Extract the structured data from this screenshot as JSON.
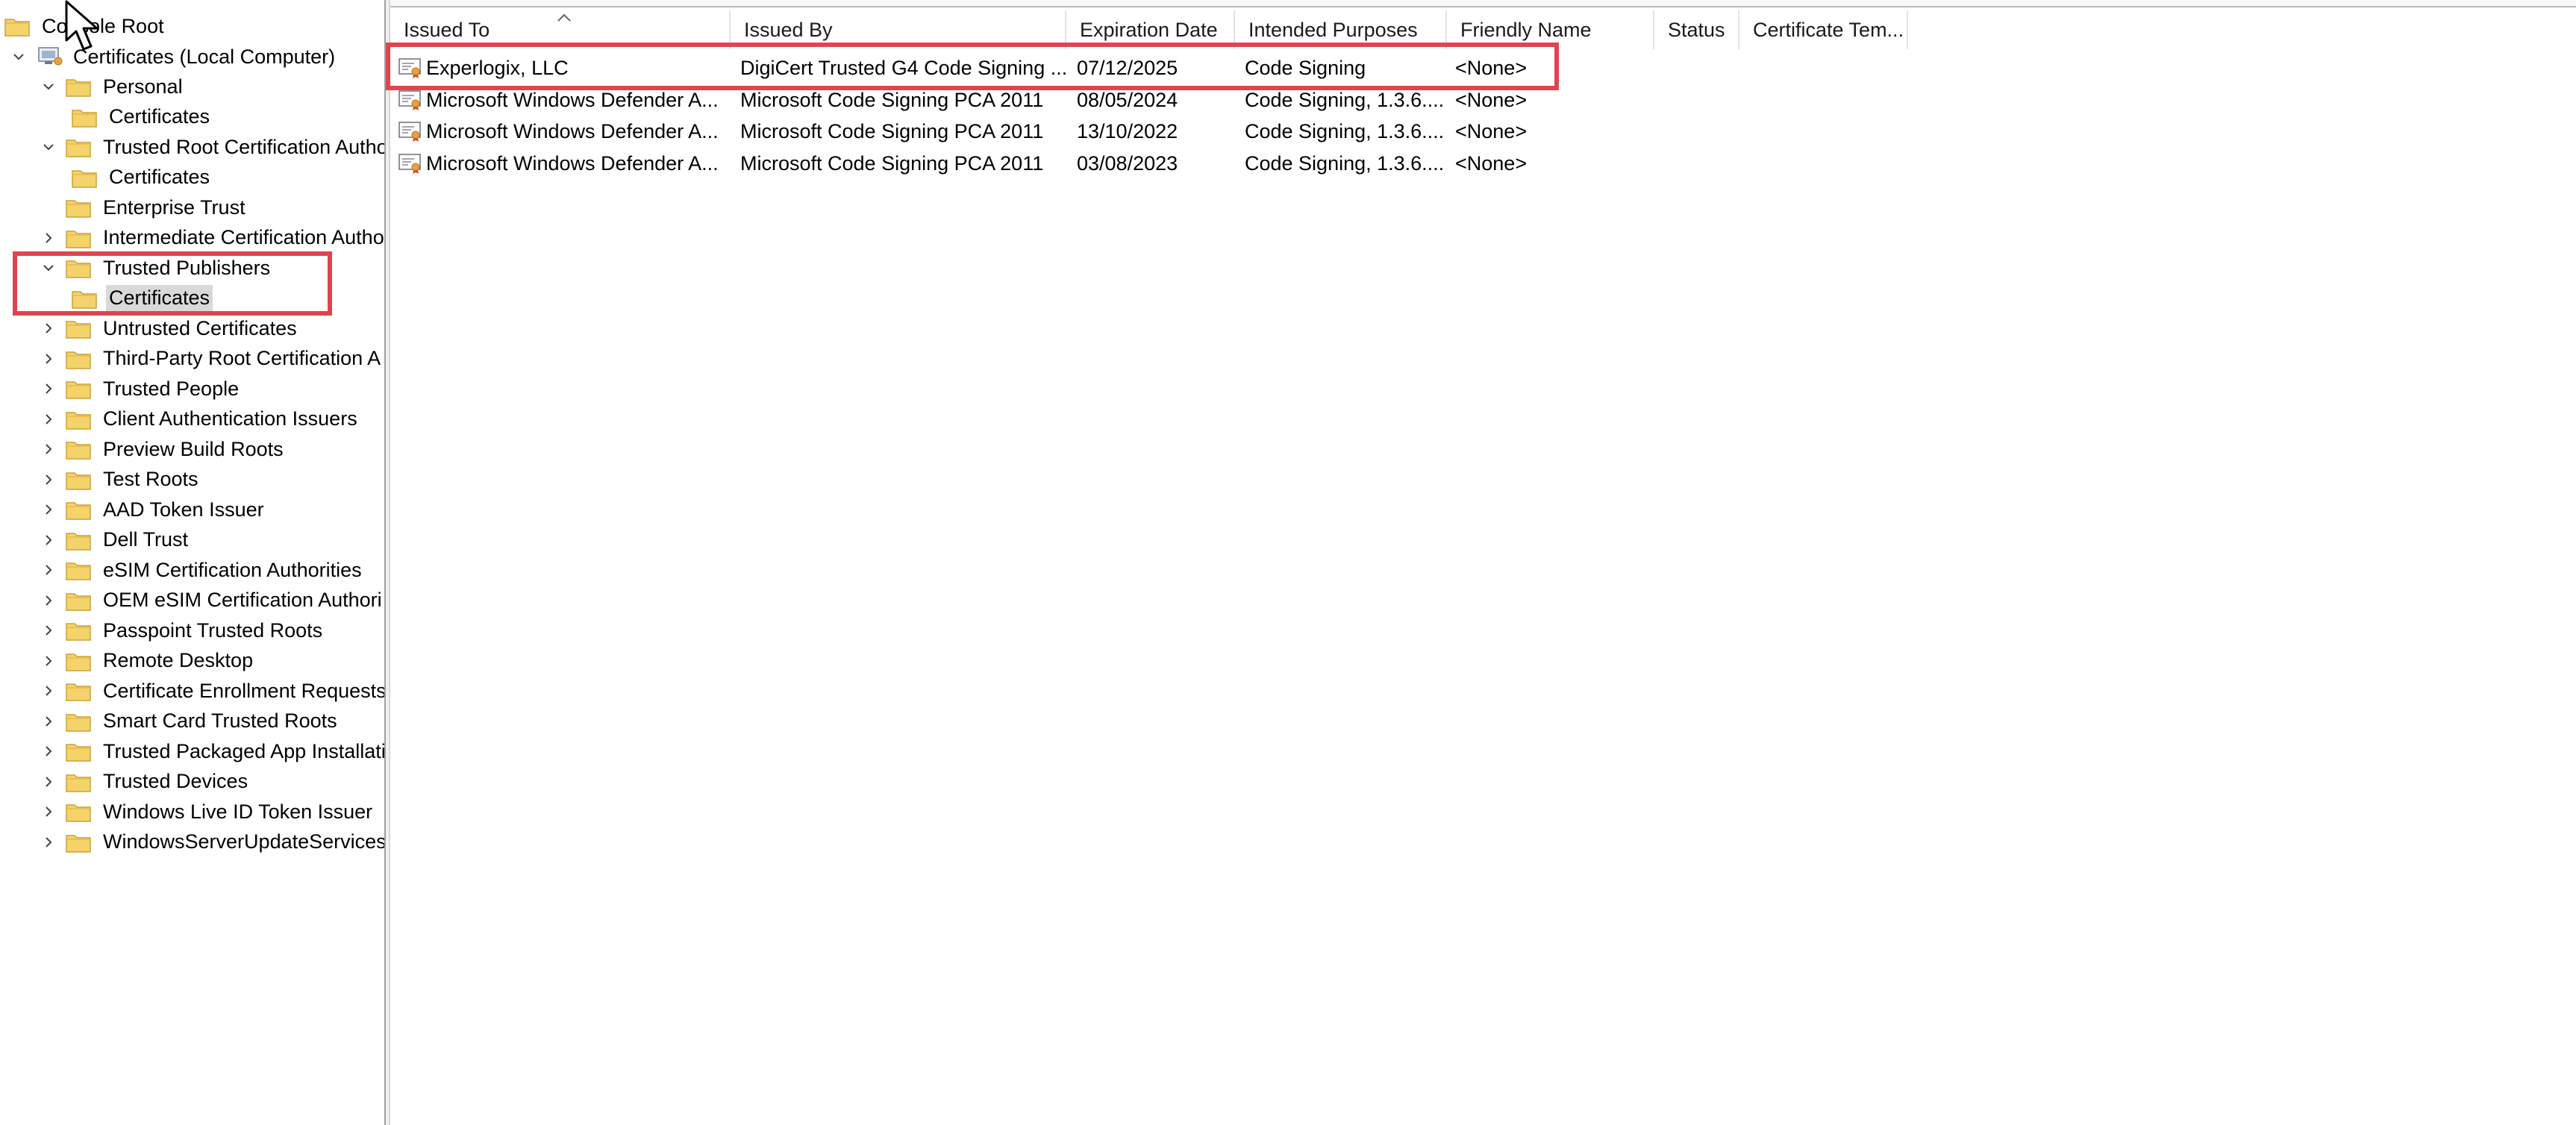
{
  "tree": {
    "root_label": "Console Root",
    "computer_label": "Certificates (Local Computer)",
    "nodes": [
      {
        "label": "Personal",
        "chevron": "down"
      },
      {
        "label": "Certificates",
        "chevron": "none"
      },
      {
        "label": "Trusted Root Certification Autho",
        "chevron": "down"
      },
      {
        "label": "Certificates",
        "chevron": "none"
      },
      {
        "label": "Enterprise Trust",
        "chevron": "none"
      },
      {
        "label": "Intermediate Certification Autho",
        "chevron": "right"
      },
      {
        "label": "Trusted Publishers",
        "chevron": "down"
      },
      {
        "label": "Certificates",
        "chevron": "none",
        "selected": true
      },
      {
        "label": "Untrusted Certificates",
        "chevron": "right"
      },
      {
        "label": "Third-Party Root Certification A",
        "chevron": "right"
      },
      {
        "label": "Trusted People",
        "chevron": "right"
      },
      {
        "label": "Client Authentication Issuers",
        "chevron": "right"
      },
      {
        "label": "Preview Build Roots",
        "chevron": "right"
      },
      {
        "label": "Test Roots",
        "chevron": "right"
      },
      {
        "label": "AAD Token Issuer",
        "chevron": "right"
      },
      {
        "label": "Dell Trust",
        "chevron": "right"
      },
      {
        "label": "eSIM Certification Authorities",
        "chevron": "right"
      },
      {
        "label": "OEM eSIM Certification Authori",
        "chevron": "right"
      },
      {
        "label": "Passpoint Trusted Roots",
        "chevron": "right"
      },
      {
        "label": "Remote Desktop",
        "chevron": "right"
      },
      {
        "label": "Certificate Enrollment Requests",
        "chevron": "right"
      },
      {
        "label": "Smart Card Trusted Roots",
        "chevron": "right"
      },
      {
        "label": "Trusted Packaged App Installatio",
        "chevron": "right"
      },
      {
        "label": "Trusted Devices",
        "chevron": "right"
      },
      {
        "label": "Windows Live ID Token Issuer",
        "chevron": "right"
      },
      {
        "label": "WindowsServerUpdateServices",
        "chevron": "right"
      }
    ]
  },
  "list": {
    "columns": [
      "Issued To",
      "Issued By",
      "Expiration Date",
      "Intended Purposes",
      "Friendly Name",
      "Status",
      "Certificate Tem..."
    ],
    "rows": [
      {
        "issued_to": "Experlogix, LLC",
        "issued_by": "DigiCert Trusted G4 Code Signing ...",
        "expiration": "07/12/2025",
        "purposes": "Code Signing",
        "friendly": "<None>"
      },
      {
        "issued_to": "Microsoft Windows Defender A...",
        "issued_by": "Microsoft Code Signing PCA 2011",
        "expiration": "08/05/2024",
        "purposes": "Code Signing, 1.3.6....",
        "friendly": "<None>"
      },
      {
        "issued_to": "Microsoft Windows Defender A...",
        "issued_by": "Microsoft Code Signing PCA 2011",
        "expiration": "13/10/2022",
        "purposes": "Code Signing, 1.3.6....",
        "friendly": "<None>"
      },
      {
        "issued_to": "Microsoft Windows Defender A...",
        "issued_by": "Microsoft Code Signing PCA 2011",
        "expiration": "03/08/2023",
        "purposes": "Code Signing, 1.3.6....",
        "friendly": "<None>"
      }
    ]
  },
  "colors": {
    "highlight": "#e0454f",
    "folder": "#f5d36b",
    "selection": "#d9d9d9"
  },
  "icons": {
    "folder": "folder-icon",
    "certificate": "certificate-icon",
    "expand": "chevron-right-icon",
    "collapse": "chevron-down-icon",
    "cursor": "mouse-pointer-icon"
  }
}
